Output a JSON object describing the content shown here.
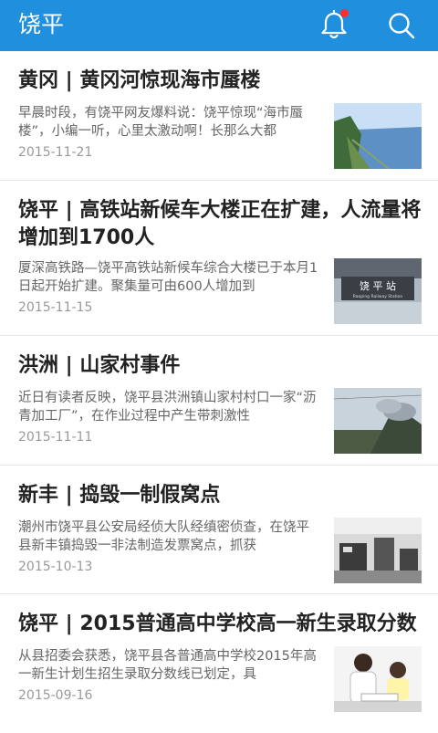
{
  "header": {
    "title": "饶平",
    "bell_icon": "bell-icon",
    "search_icon": "search-icon",
    "accent": "#1f8fde",
    "notification_color": "#ff2d2d"
  },
  "articles": [
    {
      "title": "黄冈 | 黄冈河惊现海市蜃楼",
      "summary": "早晨时段，有饶平网友爆料说：饶平惊现“海市蜃楼”，小编一听，心里太激动啊！长那么大都",
      "date": "2015-11-21",
      "thumb": "river-landscape"
    },
    {
      "title": "饶平 | 高铁站新候车大楼正在扩建，人流量将增加到1700人",
      "summary": "厦深高铁路—饶平高铁站新候车综合大楼已于本月1日起开始扩建。聚集量可由600人增加到",
      "date": "2015-11-15",
      "thumb": "station-sign",
      "thumb_text": "饶 平 站",
      "thumb_subtext": "Raoping Railway Station"
    },
    {
      "title": "洪洲 | 山家村事件",
      "summary": "近日有读者反映，饶平县洪洲镇山家村村口一家“沥青加工厂”，在作业过程中产生带刺激性",
      "date": "2015-11-11",
      "thumb": "smoke-factory"
    },
    {
      "title": "新丰 | 捣毁一制假窝点",
      "summary": "潮州市饶平县公安局经侦大队经缜密侦查，在饶平县新丰镇捣毁一非法制造发票窝点，抓获",
      "date": "2015-10-13",
      "thumb": "printing-workshop"
    },
    {
      "title": "饶平 | 2015普通高中学校高一新生录取分数",
      "summary": "从县招委会获悉，饶平县各普通高中学校2015年高一新生计划生招生录取分数线已划定，具",
      "date": "2015-09-16",
      "thumb": "students-study"
    }
  ]
}
